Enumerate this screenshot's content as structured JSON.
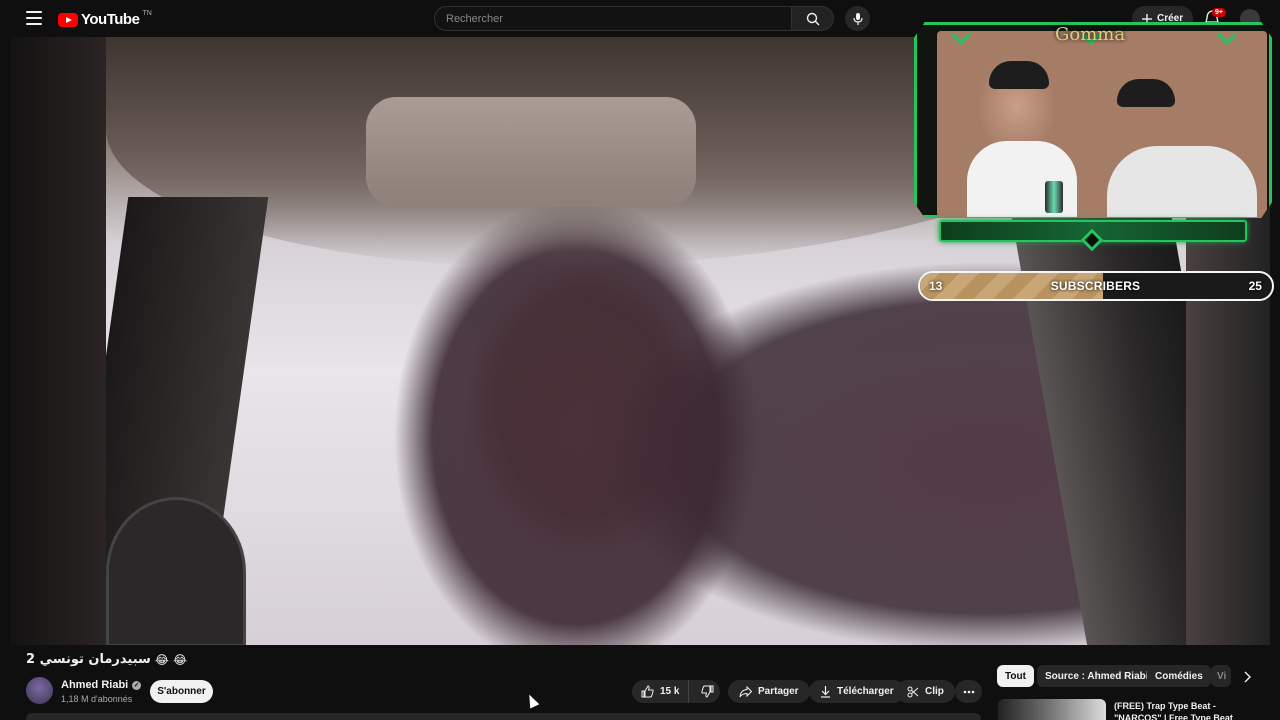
{
  "header": {
    "logo_text": "YouTube",
    "logo_country": "TN",
    "search_placeholder": "Rechercher",
    "create_label": "Créer",
    "notification_count": "9+"
  },
  "overlay": {
    "cam_name": "Gomma",
    "subscriber_goal": {
      "current": "13",
      "label": "SUBSCRIBERS",
      "target": "25",
      "progress": 0.52
    }
  },
  "video": {
    "title": "سبيدرمان تونسي 2",
    "title_emojis": "😂 😂",
    "channel_name": "Ahmed Riabi",
    "channel_subs": "1,18 M d'abonnés",
    "subscribe_label": "S'abonner",
    "like_count": "15 k",
    "share_label": "Partager",
    "download_label": "Télécharger",
    "clip_label": "Clip"
  },
  "chips": [
    "Tout",
    "Source : Ahmed Riabi",
    "Comédies",
    "Vi"
  ],
  "recommendation": {
    "title": "(FREE) Trap Type Beat - \"NARCOS\" | Free Type Beat"
  },
  "colors": {
    "accent": "#ff0000",
    "overlay_green": "#22c55e",
    "background": "#0f0f0f"
  }
}
